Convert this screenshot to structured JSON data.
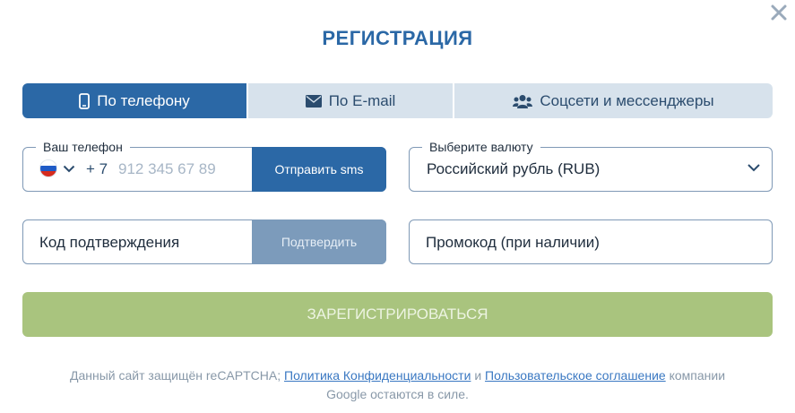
{
  "modal": {
    "title": "РЕГИСТРАЦИЯ",
    "close_icon": "close-icon"
  },
  "tabs": [
    {
      "label": "По телефону",
      "icon": "phone-icon",
      "active": true
    },
    {
      "label": "По E-mail",
      "icon": "envelope-icon",
      "active": false
    },
    {
      "label": "Соцсети и мессенджеры",
      "icon": "users-icon",
      "active": false
    }
  ],
  "phone": {
    "legend": "Ваш телефон",
    "country_flag": "russia-flag-icon",
    "prefix": "+ 7",
    "placeholder": "912 345 67 89",
    "value": "",
    "send_sms_label": "Отправить sms"
  },
  "currency": {
    "legend": "Выберите валюту",
    "selected": "Российский рубль (RUB)"
  },
  "code": {
    "placeholder": "Код подтверждения",
    "confirm_label": "Подтвердить"
  },
  "promo": {
    "placeholder": "Промокод (при наличии)"
  },
  "register_label": "ЗАРЕГИСТРИРОВАТЬСЯ",
  "footer": {
    "text_1": "Данный сайт защищён reCAPTCHA;",
    "link_privacy": "Политика Конфиденциальности",
    "text_and": "и",
    "link_terms": "Пользовательское соглашение",
    "text_2": "компании",
    "text_3": "Google остаются в силе."
  },
  "colors": {
    "primary": "#2b68a6",
    "tab_inactive": "#d7e2ec",
    "register_button": "#a9c47e",
    "confirm_disabled": "#7c9bbb",
    "link": "#3a78c2"
  }
}
